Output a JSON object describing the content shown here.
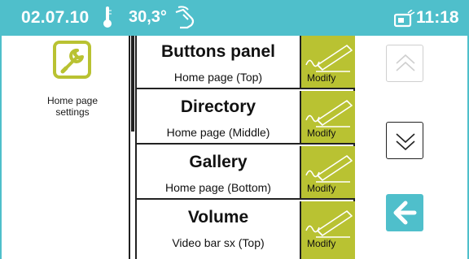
{
  "status_bar": {
    "date": "02.07.10",
    "temperature": "30,3°",
    "time": "11:18",
    "icons": [
      "thermometer-icon",
      "hand-touch-icon",
      "monitor-icon"
    ]
  },
  "settings_tile": {
    "label": "Home page settings",
    "icon": "wrench-icon"
  },
  "list": {
    "items": [
      {
        "title": "Buttons panel",
        "subtitle": "Home page (Top)",
        "action": "Modify"
      },
      {
        "title": "Directory",
        "subtitle": "Home page (Middle)",
        "action": "Modify"
      },
      {
        "title": "Gallery",
        "subtitle": "Home page (Bottom)",
        "action": "Modify"
      },
      {
        "title": "Volume",
        "subtitle": "Video bar sx (Top)",
        "action": "Modify"
      }
    ]
  },
  "controls": {
    "up_enabled": false,
    "down_enabled": true,
    "back_icon": "arrow-left-icon"
  },
  "colors": {
    "accent": "#4fbfcb",
    "olive": "#b9c232",
    "text": "#111111"
  }
}
